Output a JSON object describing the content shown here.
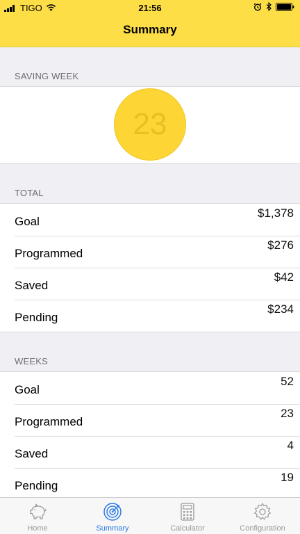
{
  "status_bar": {
    "carrier": "TIGO",
    "time": "21:56"
  },
  "nav": {
    "title": "Summary"
  },
  "saving_week": {
    "header": "SAVING WEEK",
    "value": "23"
  },
  "total": {
    "header": "TOTAL",
    "rows": [
      {
        "label": "Goal",
        "value": "$1,378"
      },
      {
        "label": "Programmed",
        "value": "$276"
      },
      {
        "label": "Saved",
        "value": "$42"
      },
      {
        "label": "Pending",
        "value": "$234"
      }
    ]
  },
  "weeks": {
    "header": "WEEKS",
    "rows": [
      {
        "label": "Goal",
        "value": "52"
      },
      {
        "label": "Programmed",
        "value": "23"
      },
      {
        "label": "Saved",
        "value": "4"
      },
      {
        "label": "Pending",
        "value": "19"
      }
    ]
  },
  "tabbar": {
    "tabs": [
      {
        "label": "Home",
        "icon": "piggy-bank-icon"
      },
      {
        "label": "Summary",
        "icon": "target-icon"
      },
      {
        "label": "Calculator",
        "icon": "calculator-icon"
      },
      {
        "label": "Configuration",
        "icon": "gear-icon"
      }
    ],
    "active": "Summary"
  },
  "colors": {
    "header_yellow": "#fdde47",
    "circle_yellow": "#fdd534",
    "active_tab": "#2c7be5"
  }
}
